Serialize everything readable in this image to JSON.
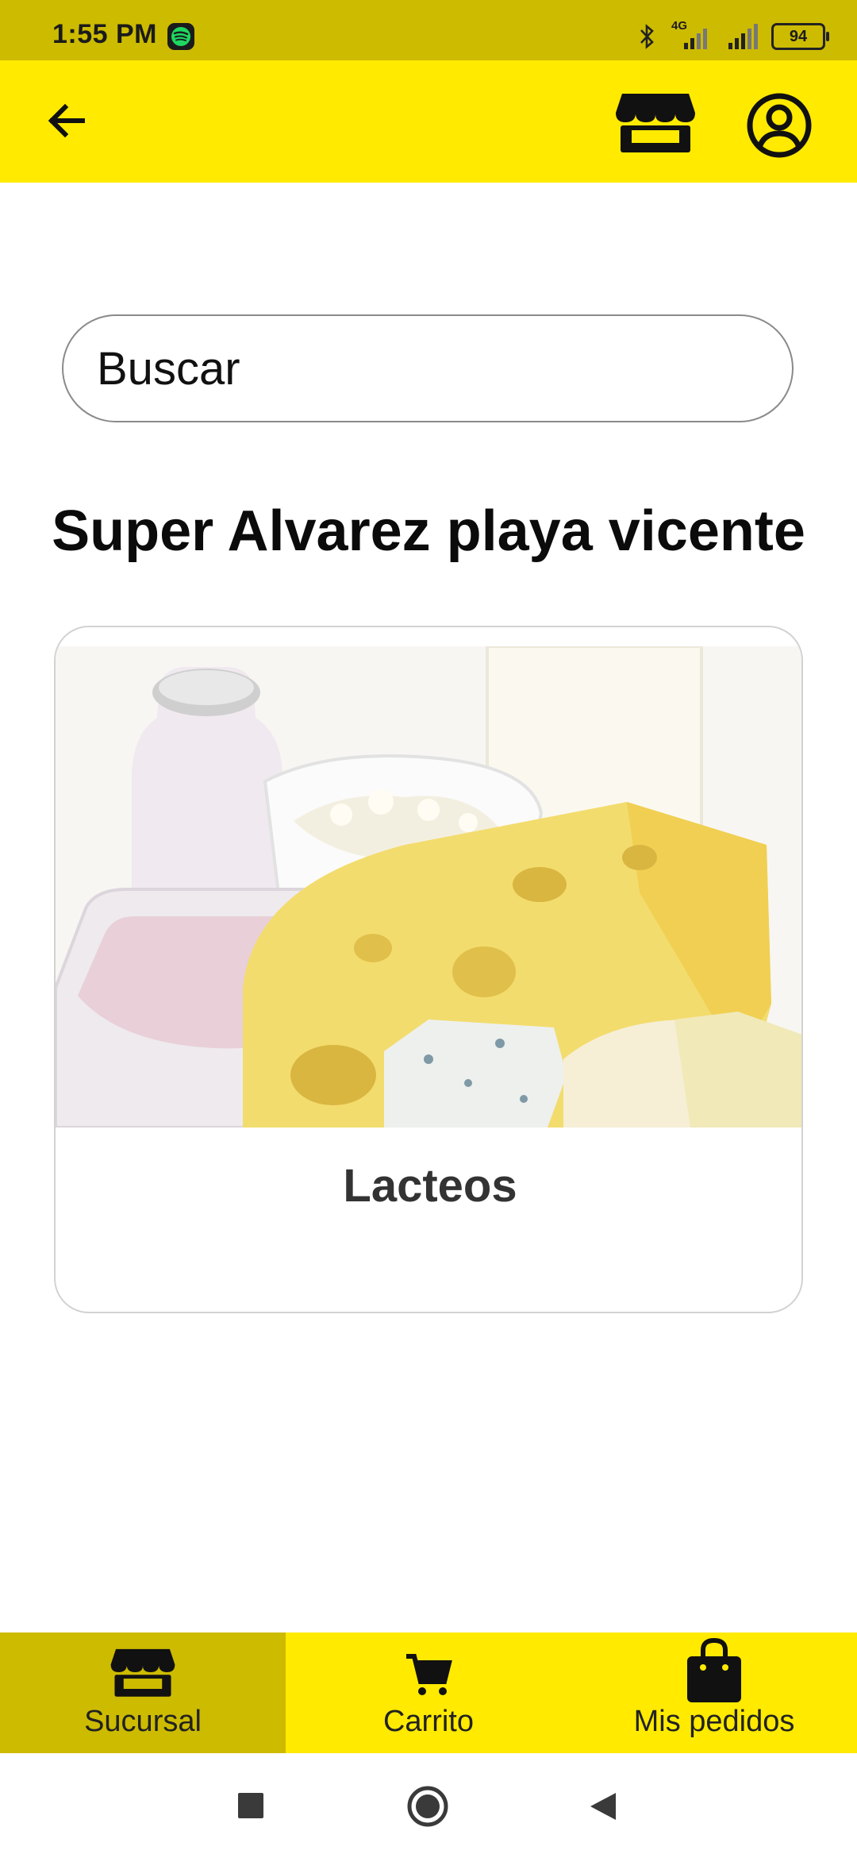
{
  "status": {
    "time": "1:55 PM",
    "network": "4G",
    "battery": "94"
  },
  "app_bar": {
    "back_icon": "arrow-left-icon",
    "store_icon": "storefront-icon",
    "account_icon": "account-circle-icon"
  },
  "search": {
    "placeholder": "Buscar"
  },
  "store": {
    "name": "Super Alvarez playa vicente"
  },
  "categories": [
    {
      "label": "Lacteos",
      "image": "dairy-products-image"
    }
  ],
  "bottom_nav": {
    "items": [
      {
        "label": "Sucursal",
        "icon": "storefront-icon",
        "active": true
      },
      {
        "label": "Carrito",
        "icon": "shopping-cart-icon",
        "active": false
      },
      {
        "label": "Mis pedidos",
        "icon": "shopping-bag-icon",
        "active": false
      }
    ]
  },
  "colors": {
    "app_bar": "#ffea00",
    "status_bar": "#cdbb00",
    "nav_active": "#cdbb00"
  }
}
